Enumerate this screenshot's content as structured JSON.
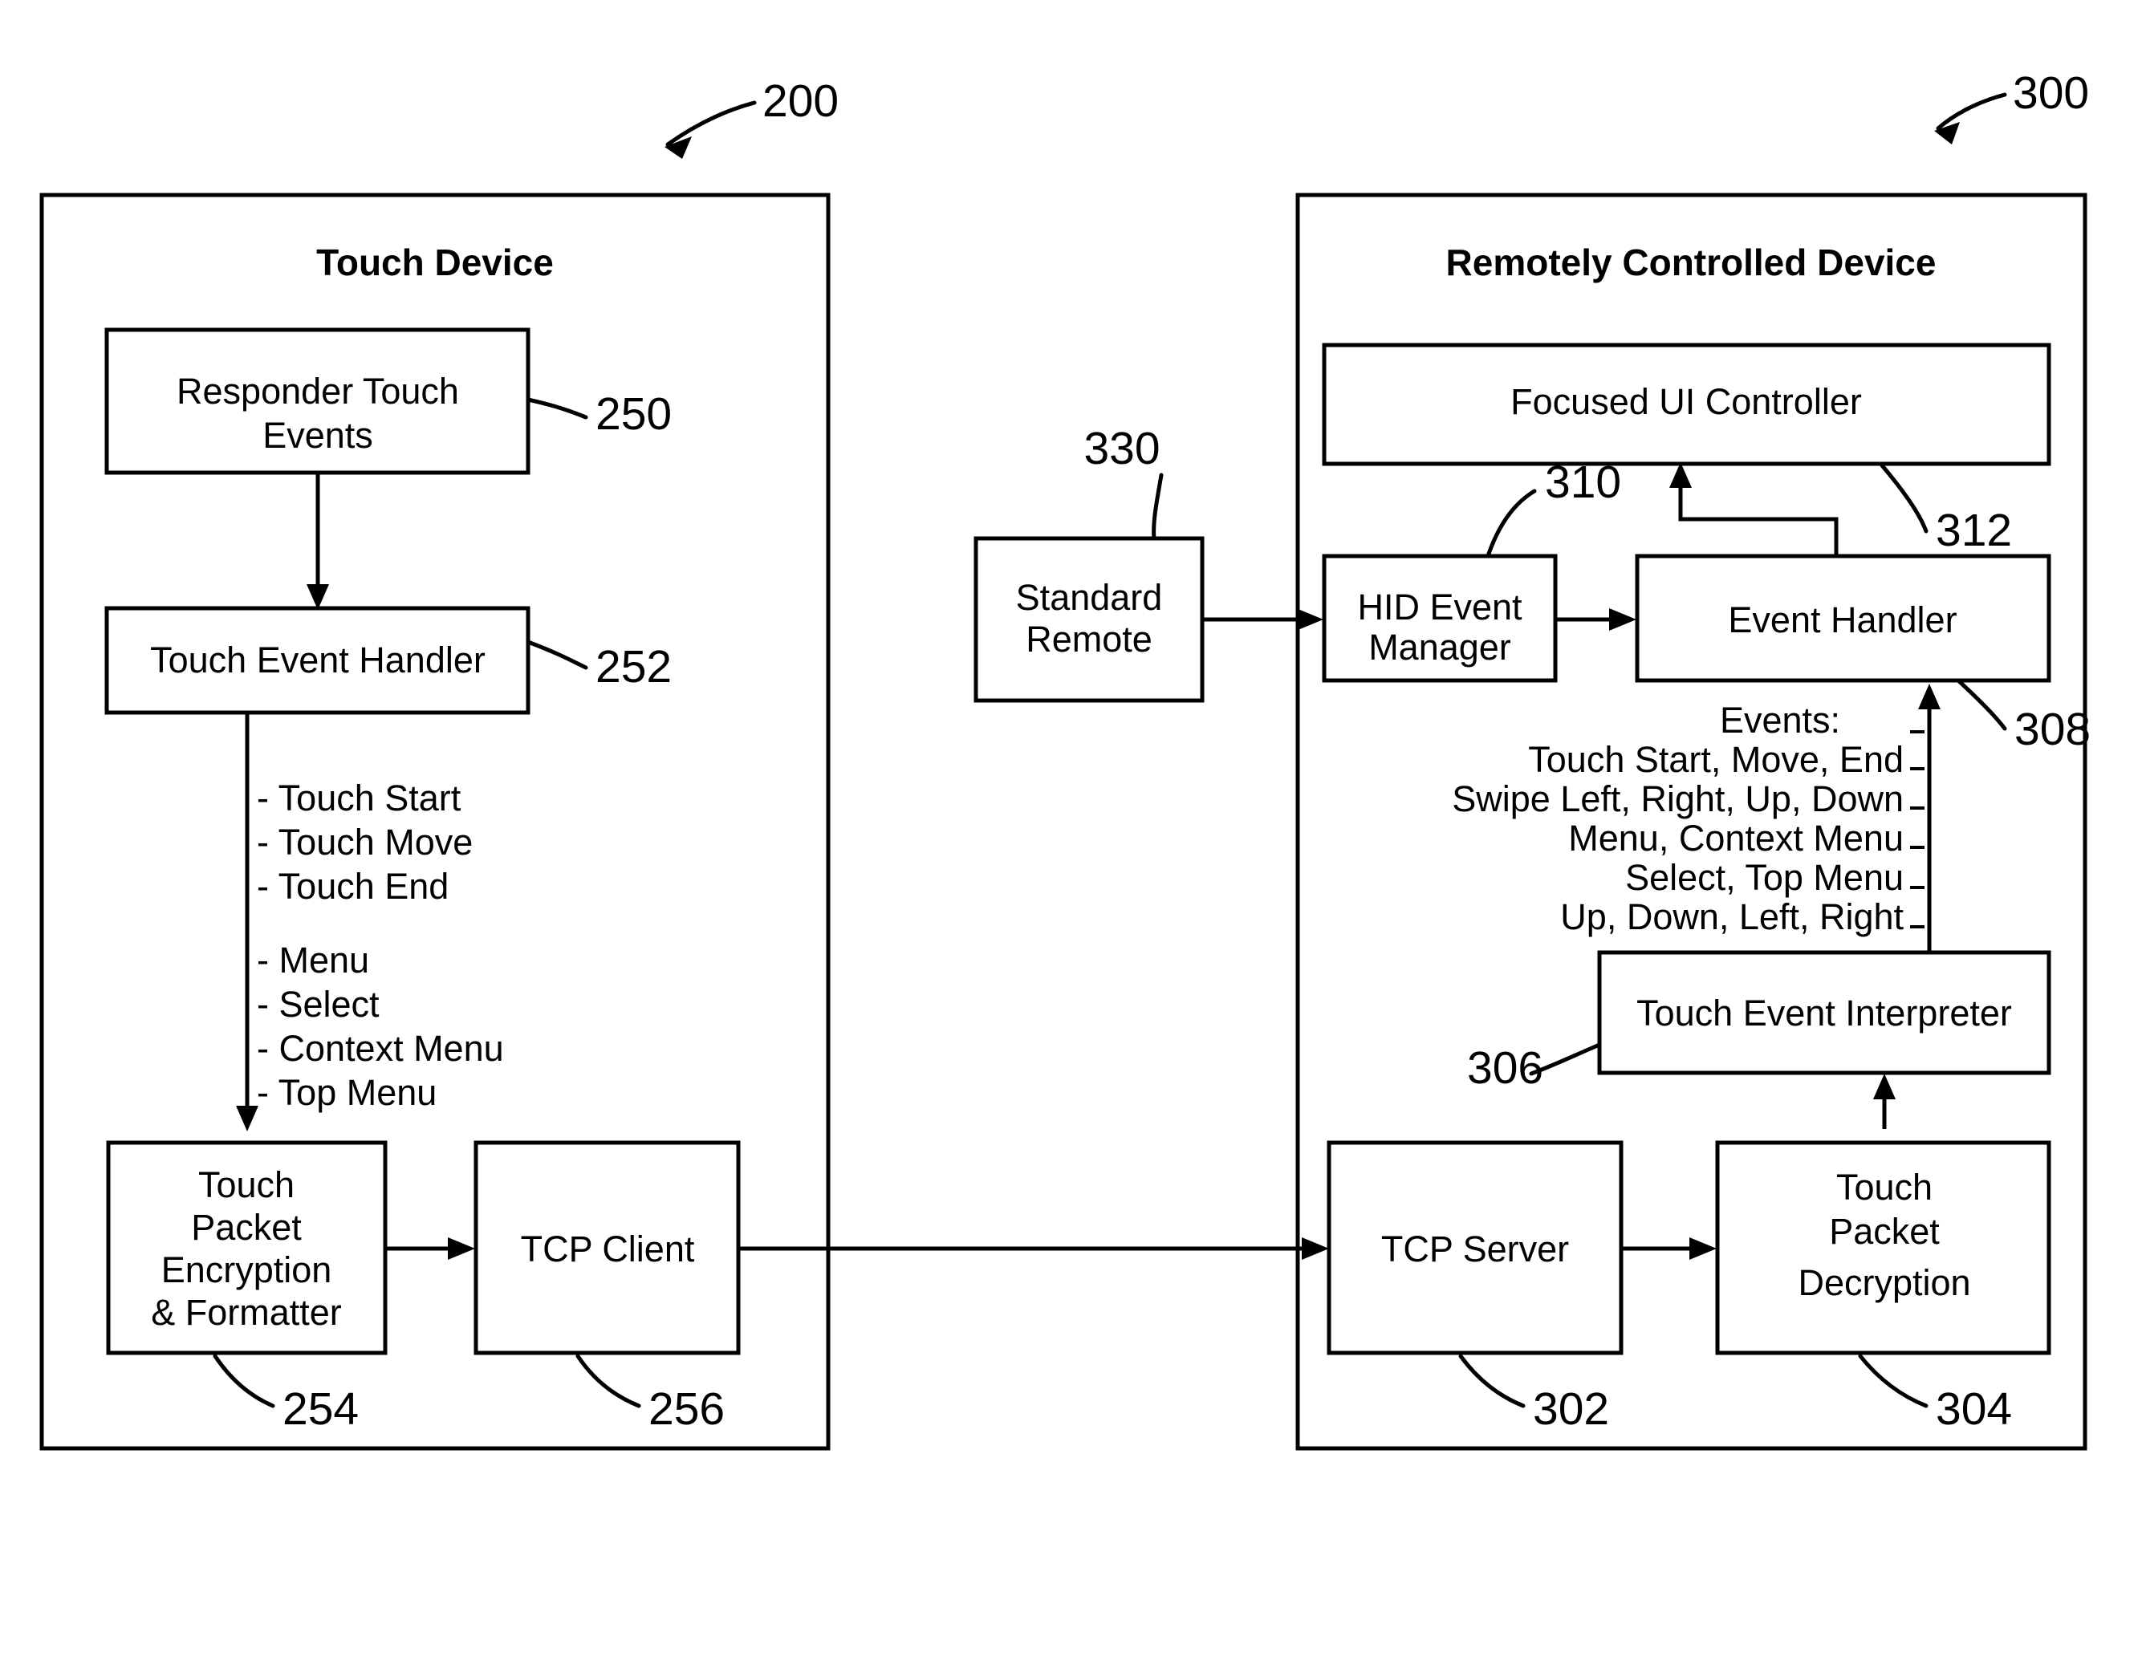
{
  "figure": {
    "left_panel": {
      "ref_label": "200",
      "title": "Touch Device",
      "boxes": [
        {
          "id": "responder-touch-events",
          "label": "Responder Touch Events",
          "ref": "250"
        },
        {
          "id": "touch-event-handler",
          "label": "Touch Event Handler",
          "ref": "252"
        },
        {
          "id": "touch-packet-encryption",
          "label": "Touch Packet Encryption & Formatter",
          "ref": "254"
        },
        {
          "id": "tcp-client",
          "label": "TCP Client",
          "ref": "256"
        }
      ],
      "event_list_group_a": [
        "- Touch Start",
        "- Touch Move",
        "- Touch End"
      ],
      "event_list_group_b": [
        "- Menu",
        "- Select",
        "- Context Menu",
        "- Top Menu"
      ]
    },
    "right_panel": {
      "ref_label": "300",
      "title": "Remotely Controlled Device",
      "boxes": [
        {
          "id": "focused-ui-controller",
          "label": "Focused UI Controller",
          "ref": "312"
        },
        {
          "id": "hid-event-manager",
          "label": "HID Event Manager",
          "ref": "310"
        },
        {
          "id": "event-handler",
          "label": "Event Handler",
          "ref": "308"
        },
        {
          "id": "touch-event-interpreter",
          "label": "Touch Event Interpreter",
          "ref": "306"
        },
        {
          "id": "tcp-server",
          "label": "TCP Server",
          "ref": "302"
        },
        {
          "id": "touch-packet-decryption",
          "label": "Touch Packet Decryption",
          "ref": "304"
        }
      ],
      "events_annotation": {
        "heading": "Events:",
        "lines": [
          "Touch Start, Move, End",
          "Swipe Left, Right, Up, Down",
          "Menu, Context Menu",
          "Select, Top Menu",
          "Up, Down, Left, Right"
        ]
      }
    },
    "standard_remote": {
      "id": "standard-remote",
      "label_line1": "Standard",
      "label_line2": "Remote",
      "ref": "330"
    },
    "box_labels": {
      "responder_line1": "Responder Touch",
      "responder_line2": "Events",
      "touch_event_handler": "Touch Event Handler",
      "encryption_line1": "Touch",
      "encryption_line2": "Packet",
      "encryption_line3": "Encryption",
      "encryption_line4": "& Formatter",
      "tcp_client": "TCP Client",
      "focused_ui_controller": "Focused UI Controller",
      "hid_line1": "HID Event",
      "hid_line2": "Manager",
      "event_handler": "Event Handler",
      "touch_event_interpreter": "Touch Event Interpreter",
      "tcp_server": "TCP Server",
      "decryption_line1": "Touch",
      "decryption_line2": "Packet",
      "decryption_line3": "Decryption"
    },
    "refs": {
      "r200": "200",
      "r250": "250",
      "r252": "252",
      "r254": "254",
      "r256": "256",
      "r300": "300",
      "r302": "302",
      "r304": "304",
      "r306": "306",
      "r308": "308",
      "r310": "310",
      "r312": "312",
      "r330": "330"
    },
    "list_left": {
      "l1": "- Touch Start",
      "l2": "- Touch Move",
      "l3": "- Touch End",
      "l4": "- Menu",
      "l5": "- Select",
      "l6": "- Context Menu",
      "l7": "- Top Menu"
    },
    "events_right": {
      "e0": "Events:",
      "e1": "Touch Start, Move, End",
      "e2": "Swipe Left, Right, Up, Down",
      "e3": "Menu, Context Menu",
      "e4": "Select, Top Menu",
      "e5": "Up, Down, Left, Right"
    }
  }
}
